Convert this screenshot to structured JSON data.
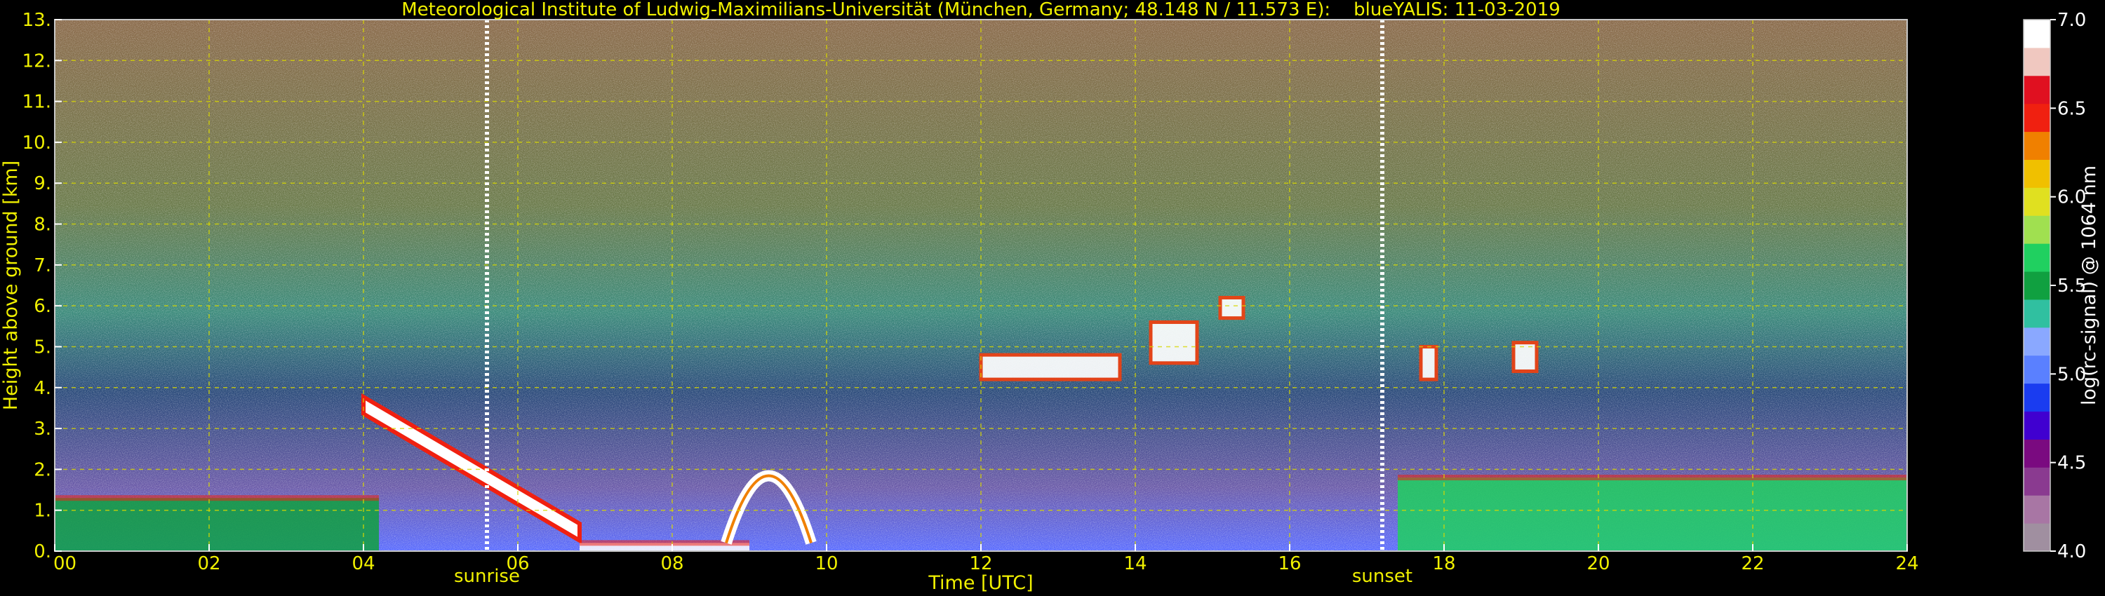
{
  "chart_data": {
    "type": "heatmap",
    "title": "Meteorological Institute of Ludwig-Maximilians-Universität (München, Germany; 48.148 N / 11.573 E):    blueYALIS: 11-03-2019",
    "xlabel": "Time [UTC]",
    "ylabel": "Height above ground [km]",
    "xlim": [
      0,
      24
    ],
    "ylim": [
      0,
      13
    ],
    "x_ticks": [
      0,
      2,
      4,
      6,
      8,
      10,
      12,
      14,
      16,
      18,
      20,
      22,
      24
    ],
    "x_tick_labels": [
      "00",
      "02",
      "04",
      "06",
      "08",
      "10",
      "12",
      "14",
      "16",
      "18",
      "20",
      "22",
      "24"
    ],
    "y_ticks": [
      0,
      1,
      2,
      3,
      4,
      5,
      6,
      7,
      8,
      9,
      10,
      11,
      12,
      13
    ],
    "y_tick_labels": [
      "0.",
      "1.",
      "2.",
      "3.",
      "4.",
      "5.",
      "6.",
      "7.",
      "8.",
      "9.",
      "10.",
      "11.",
      "12.",
      "13."
    ],
    "grid": true,
    "colorbar": {
      "label": "log(rc-signal) @ 1064 nm",
      "range": [
        4.0,
        7.0
      ],
      "ticks": [
        4.0,
        4.5,
        5.0,
        5.5,
        6.0,
        6.5,
        7.0
      ],
      "tick_labels": [
        "4.0",
        "4.5",
        "5.0",
        "5.5",
        "6.0",
        "6.5",
        "7.0"
      ],
      "colors": [
        "#a08fa0",
        "#a876a4",
        "#8a3a90",
        "#7a0a80",
        "#4000d0",
        "#1a3cf0",
        "#5a80ff",
        "#8aa8ff",
        "#30c0a0",
        "#10a040",
        "#20d060",
        "#a0e050",
        "#e0e020",
        "#f0c000",
        "#f08000",
        "#f02010",
        "#e01020",
        "#f0c8c0",
        "#ffffff"
      ]
    },
    "markers": [
      {
        "label": "sunrise",
        "x": 5.6
      },
      {
        "label": "sunset",
        "x": 17.2
      }
    ],
    "features": [
      {
        "kind": "boundary-layer",
        "start": 0.0,
        "end": 4.2,
        "top_km": 1.3,
        "level": 5.5
      },
      {
        "kind": "aerosol-plume",
        "start": 4.0,
        "end": 6.8,
        "from_km": 3.6,
        "to_km": 0.5,
        "level": 7.0
      },
      {
        "kind": "surface-layer",
        "start": 6.8,
        "end": 9.0,
        "top_km": 0.2,
        "level": 7.0
      },
      {
        "kind": "aerosol-arc",
        "start": 8.7,
        "end": 9.8,
        "peak_km": 2.8,
        "level": 6.8
      },
      {
        "kind": "cloud-layer",
        "start": 12.0,
        "end": 13.8,
        "base_km": 4.2,
        "top_km": 4.8,
        "level": 6.9
      },
      {
        "kind": "cloud-layer",
        "start": 14.2,
        "end": 14.8,
        "base_km": 4.6,
        "top_km": 5.6,
        "level": 6.9
      },
      {
        "kind": "cloud",
        "start": 15.1,
        "end": 15.4,
        "base_km": 5.7,
        "top_km": 6.2,
        "level": 6.8
      },
      {
        "kind": "boundary-layer",
        "start": 17.4,
        "end": 24.0,
        "top_km": 1.8,
        "level": 5.6
      },
      {
        "kind": "cloud",
        "start": 17.7,
        "end": 17.9,
        "base_km": 4.2,
        "top_km": 5.0,
        "level": 6.6
      },
      {
        "kind": "cloud",
        "start": 18.9,
        "end": 19.2,
        "base_km": 4.4,
        "top_km": 5.1,
        "level": 6.4
      }
    ]
  }
}
